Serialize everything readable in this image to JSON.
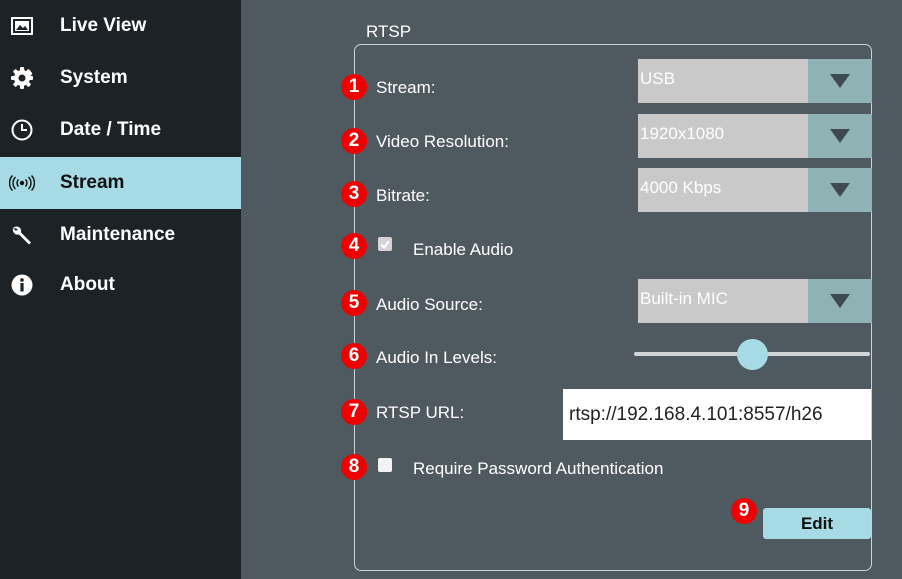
{
  "sidebar": {
    "items": [
      {
        "label": "Live View",
        "icon": "live-view-icon"
      },
      {
        "label": "System",
        "icon": "gear-icon"
      },
      {
        "label": "Date / Time",
        "icon": "clock-icon"
      },
      {
        "label": "Stream",
        "icon": "broadcast-icon",
        "active": true
      },
      {
        "label": "Maintenance",
        "icon": "wrench-icon"
      },
      {
        "label": "About",
        "icon": "info-icon"
      }
    ]
  },
  "main": {
    "section_title": "RTSP",
    "markers": [
      "1",
      "2",
      "3",
      "4",
      "5",
      "6",
      "7",
      "8",
      "9"
    ],
    "stream": {
      "label": "Stream:",
      "value": "USB"
    },
    "video_resolution": {
      "label": "Video Resolution:",
      "value": "1920x1080"
    },
    "bitrate": {
      "label": "Bitrate:",
      "value": "4000 Kbps"
    },
    "enable_audio": {
      "label": "Enable Audio",
      "checked": true
    },
    "audio_source": {
      "label": "Audio Source:",
      "value": "Built-in MIC"
    },
    "audio_in_levels": {
      "label": "Audio In Levels:",
      "level_fraction": 0.5
    },
    "rtsp_url": {
      "label": "RTSP URL:",
      "value": "rtsp://192.168.4.101:8557/h26"
    },
    "require_password": {
      "label": "Require Password Authentication",
      "checked": false
    },
    "edit_label": "Edit"
  },
  "colors": {
    "sidebar_bg": "#1c2226",
    "active_nav": "#a6dbe6",
    "content_bg": "#4f5a60",
    "marker": "#ee0000",
    "select_button": "#8fb2b5"
  }
}
